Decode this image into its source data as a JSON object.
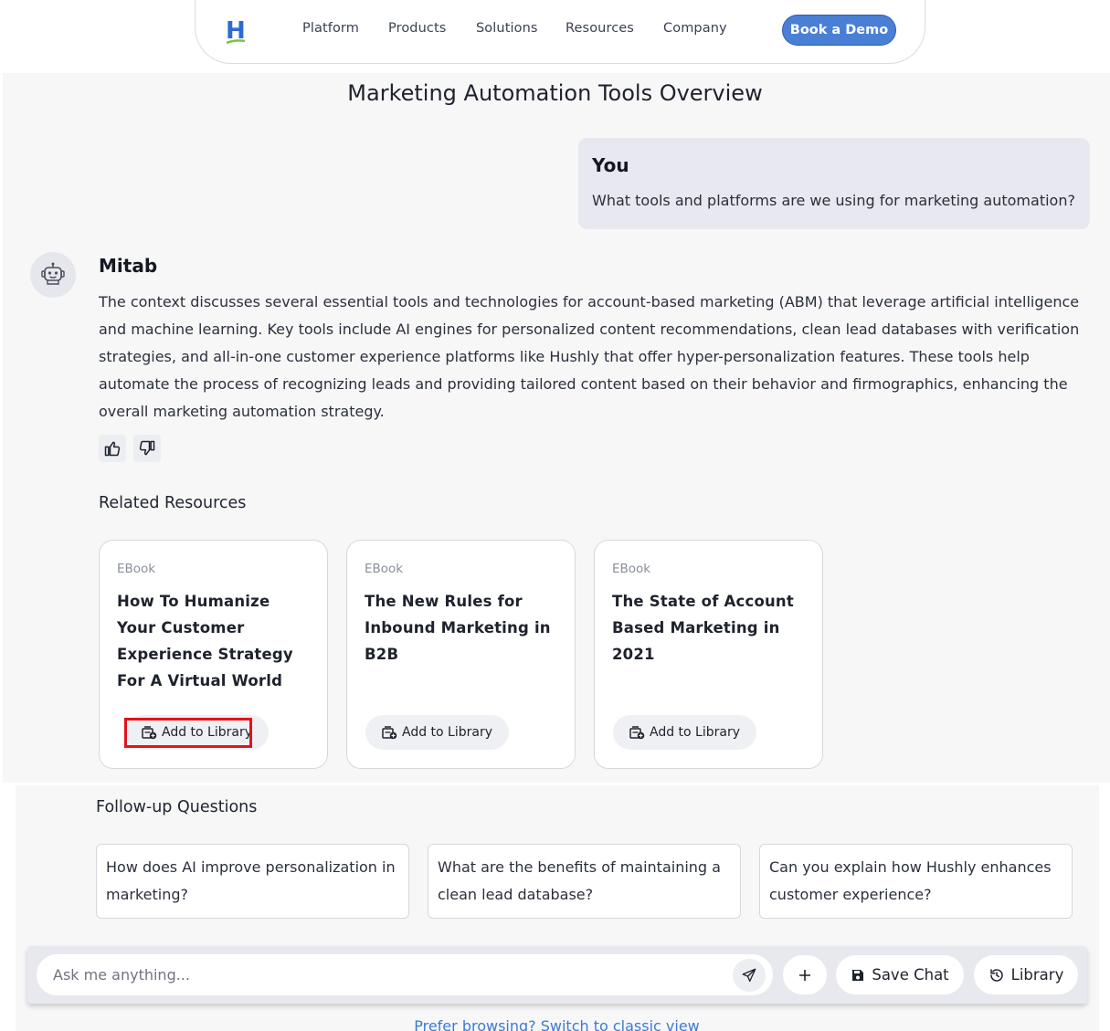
{
  "nav": {
    "logo_letter": "H",
    "links": [
      "Platform",
      "Products",
      "Solutions",
      "Resources",
      "Company"
    ],
    "cta": "Book a Demo"
  },
  "page": {
    "title": "Marketing Automation Tools Overview"
  },
  "user_message": {
    "author": "You",
    "text": "What tools and platforms are we using for marketing automation?"
  },
  "bot_message": {
    "author": "Mitab",
    "text": "The context discusses several essential tools and technologies for account-based marketing (ABM) that leverage artificial intelligence and machine learning. Key tools include AI engines for personalized content recommendations, clean lead databases with verification strategies, and all-in-one customer experience platforms like Hushly that offer hyper-personalization features. These tools help automate the process of recognizing leads and providing tailored content based on their behavior and firmographics, enhancing the overall marketing automation strategy."
  },
  "related": {
    "heading": "Related Resources",
    "items": [
      {
        "type": "EBook",
        "title": "How To Humanize Your Customer Experience Strategy For A Virtual World",
        "action": "Add to Library"
      },
      {
        "type": "EBook",
        "title": "The New Rules for Inbound Marketing in B2B",
        "action": "Add to Library"
      },
      {
        "type": "EBook",
        "title": "The State of Account Based Marketing in 2021",
        "action": "Add to Library"
      }
    ]
  },
  "followup": {
    "heading": "Follow-up Questions",
    "items": [
      "How does AI improve personalization in marketing?",
      "What are the benefits of maintaining a clean lead database?",
      "Can you explain how Hushly enhances customer experience?"
    ]
  },
  "composer": {
    "placeholder": "Ask me anything...",
    "save_label": "Save Chat",
    "library_label": "Library"
  },
  "footer_link": "Prefer browsing? Switch to classic view",
  "colors": {
    "accent": "#4a7fd6",
    "highlight": "#e0141c",
    "link": "#3b7ad9"
  },
  "icons": [
    "send-icon",
    "plus-icon",
    "save-icon",
    "history-icon",
    "thumbs-up-icon",
    "thumbs-down-icon",
    "robot-icon",
    "library-add-icon"
  ]
}
